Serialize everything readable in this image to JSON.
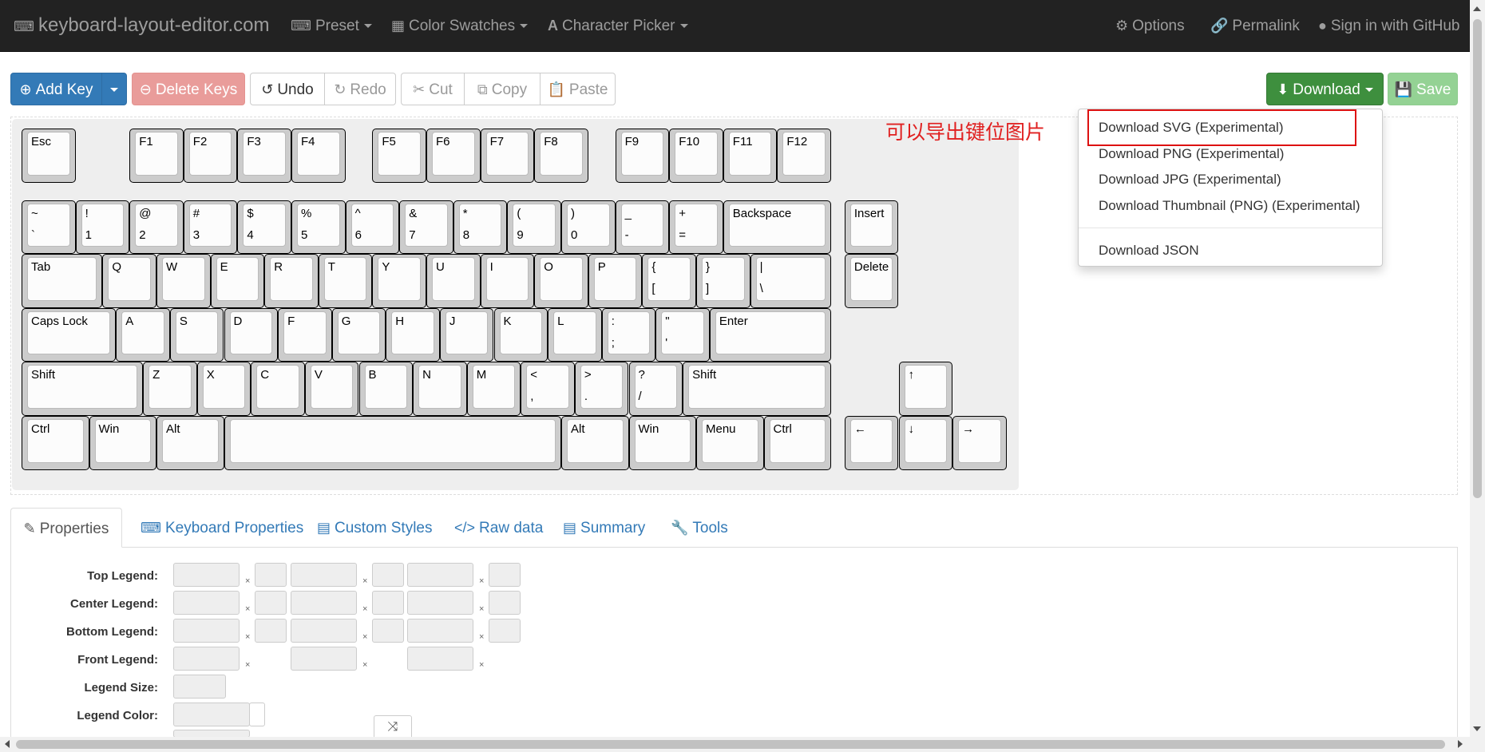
{
  "navbar": {
    "brand": "keyboard-layout-editor.com",
    "preset": "Preset",
    "color_swatches": "Color Swatches",
    "character_picker": "Character Picker",
    "options": "Options",
    "permalink": "Permalink",
    "sign_in": "Sign in with GitHub"
  },
  "toolbar": {
    "add_key": "Add Key",
    "delete_keys": "Delete Keys",
    "undo": "Undo",
    "redo": "Redo",
    "cut": "Cut",
    "copy": "Copy",
    "paste": "Paste",
    "download": "Download",
    "save": "Save"
  },
  "download_menu": {
    "items": [
      "Download SVG (Experimental)",
      "Download PNG (Experimental)",
      "Download JPG (Experimental)",
      "Download Thumbnail (PNG) (Experimental)",
      "Download JSON"
    ]
  },
  "annotation": "可以导出键位图片",
  "keyboard": {
    "rows": [
      [
        [
          "Esc",
          ""
        ],
        [
          "F1",
          ""
        ],
        [
          "F2",
          ""
        ],
        [
          "F3",
          ""
        ],
        [
          "F4",
          ""
        ],
        [
          "F5",
          ""
        ],
        [
          "F6",
          ""
        ],
        [
          "F7",
          ""
        ],
        [
          "F8",
          ""
        ],
        [
          "F9",
          ""
        ],
        [
          "F10",
          ""
        ],
        [
          "F11",
          ""
        ],
        [
          "F12",
          ""
        ]
      ],
      [
        [
          "~",
          "`"
        ],
        [
          "!",
          "1"
        ],
        [
          "@",
          "2"
        ],
        [
          "#",
          "3"
        ],
        [
          "$",
          "4"
        ],
        [
          "%",
          "5"
        ],
        [
          "^",
          "6"
        ],
        [
          "&",
          "7"
        ],
        [
          "*",
          "8"
        ],
        [
          "(",
          "9"
        ],
        [
          ")",
          "0"
        ],
        [
          "_",
          "-"
        ],
        [
          "+",
          "="
        ],
        [
          "Backspace",
          ""
        ],
        [
          "Insert",
          ""
        ]
      ],
      [
        [
          "Tab",
          ""
        ],
        [
          "Q",
          ""
        ],
        [
          "W",
          ""
        ],
        [
          "E",
          ""
        ],
        [
          "R",
          ""
        ],
        [
          "T",
          ""
        ],
        [
          "Y",
          ""
        ],
        [
          "U",
          ""
        ],
        [
          "I",
          ""
        ],
        [
          "O",
          ""
        ],
        [
          "P",
          ""
        ],
        [
          "{",
          "["
        ],
        [
          "}",
          "]"
        ],
        [
          "|",
          "\\"
        ],
        [
          "Delete",
          ""
        ]
      ],
      [
        [
          "Caps Lock",
          ""
        ],
        [
          "A",
          ""
        ],
        [
          "S",
          ""
        ],
        [
          "D",
          ""
        ],
        [
          "F",
          ""
        ],
        [
          "G",
          ""
        ],
        [
          "H",
          ""
        ],
        [
          "J",
          ""
        ],
        [
          "K",
          ""
        ],
        [
          "L",
          ""
        ],
        [
          ":",
          ";"
        ],
        [
          "\"",
          "'"
        ],
        [
          "Enter",
          ""
        ]
      ],
      [
        [
          "Shift",
          ""
        ],
        [
          "Z",
          ""
        ],
        [
          "X",
          ""
        ],
        [
          "C",
          ""
        ],
        [
          "V",
          ""
        ],
        [
          "B",
          ""
        ],
        [
          "N",
          ""
        ],
        [
          "M",
          ""
        ],
        [
          "<",
          ","
        ],
        [
          ">",
          "."
        ],
        [
          "?",
          "/"
        ],
        [
          "Shift",
          ""
        ],
        [
          "↑",
          ""
        ]
      ],
      [
        [
          "Ctrl",
          ""
        ],
        [
          "Win",
          ""
        ],
        [
          "Alt",
          ""
        ],
        [
          "",
          ""
        ],
        [
          "Alt",
          ""
        ],
        [
          "Win",
          ""
        ],
        [
          "Menu",
          ""
        ],
        [
          "Ctrl",
          ""
        ],
        [
          "←",
          ""
        ],
        [
          "↓",
          ""
        ],
        [
          "→",
          ""
        ]
      ]
    ]
  },
  "tabs": {
    "properties": "Properties",
    "keyboard_properties": "Keyboard Properties",
    "custom_styles": "Custom Styles",
    "raw_data": "Raw data",
    "summary": "Summary",
    "tools": "Tools"
  },
  "properties": {
    "top_legend": "Top Legend:",
    "center_legend": "Center Legend:",
    "bottom_legend": "Bottom Legend:",
    "front_legend": "Front Legend:",
    "legend_size": "Legend Size:",
    "legend_color": "Legend Color:"
  },
  "icons": {
    "brand": "keyboard-icon",
    "preset": "keyboard-icon",
    "color_swatches": "grid-icon",
    "character_picker": "font-icon",
    "options": "gear-icon",
    "permalink": "link-icon",
    "github": "github-icon",
    "add_key": "plus-circle-icon",
    "delete_keys": "minus-circle-icon",
    "undo": "undo-icon",
    "redo": "redo-icon",
    "cut": "scissors-icon",
    "copy": "copy-icon",
    "paste": "paste-icon",
    "download": "download-icon",
    "save": "save-icon"
  },
  "colors": {
    "navbar_bg": "#222222",
    "primary": "#337ab7",
    "danger_disabled": "#e99c9a",
    "success": "#3e8f3e",
    "success_disabled": "#94d294",
    "annotation": "#e02020"
  }
}
